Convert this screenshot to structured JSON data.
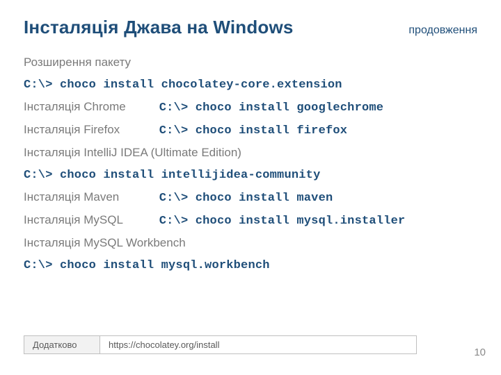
{
  "header": {
    "title": "Інсталяція Джава на Windows",
    "subtitle": "продовження"
  },
  "body": {
    "ext_label": "Розширення пакету",
    "ext_cmd": "C:\\> choco install chocolatey-core.extension",
    "chrome_label": "Інсталяція Chrome",
    "chrome_cmd": "C:\\> choco install googlechrome",
    "firefox_label": "Інсталяція Firefox",
    "firefox_cmd": "C:\\> choco install firefox",
    "intellij_label": "Інсталяція IntelliJ IDEA (Ultimate Edition)",
    "intellij_cmd": "C:\\> choco install intellijidea-community",
    "maven_label": "Інсталяція Maven",
    "maven_cmd": "C:\\> choco install maven",
    "mysql_label": "Інсталяція MySQL",
    "mysql_cmd": "C:\\> choco install mysql.installer",
    "workbench_label": "Інсталяція MySQL Workbench",
    "workbench_cmd": "C:\\> choco install mysql.workbench"
  },
  "footer": {
    "label": "Додатково",
    "url": "https://chocolatey.org/install"
  },
  "page_number": "10"
}
